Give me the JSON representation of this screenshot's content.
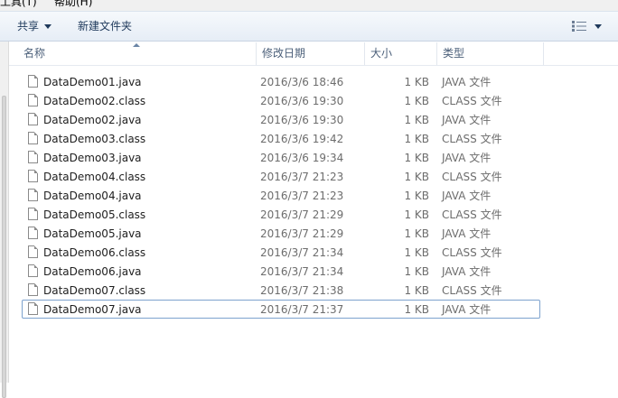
{
  "menu": {
    "tools": "工具(T)",
    "help": "帮助(H)"
  },
  "toolbar": {
    "share_label": "共享",
    "new_folder_label": "新建文件夹"
  },
  "columns": {
    "name": "名称",
    "date": "修改日期",
    "size": "大小",
    "type": "类型"
  },
  "files": [
    {
      "name": "DataDemo01.java",
      "date": "2016/3/6 18:46",
      "size": "1 KB",
      "type": "JAVA 文件"
    },
    {
      "name": "DataDemo02.class",
      "date": "2016/3/6 19:30",
      "size": "1 KB",
      "type": "CLASS 文件"
    },
    {
      "name": "DataDemo02.java",
      "date": "2016/3/6 19:30",
      "size": "1 KB",
      "type": "JAVA 文件"
    },
    {
      "name": "DataDemo03.class",
      "date": "2016/3/6 19:42",
      "size": "1 KB",
      "type": "CLASS 文件"
    },
    {
      "name": "DataDemo03.java",
      "date": "2016/3/6 19:34",
      "size": "1 KB",
      "type": "JAVA 文件"
    },
    {
      "name": "DataDemo04.class",
      "date": "2016/3/7 21:23",
      "size": "1 KB",
      "type": "CLASS 文件"
    },
    {
      "name": "DataDemo04.java",
      "date": "2016/3/7 21:23",
      "size": "1 KB",
      "type": "JAVA 文件"
    },
    {
      "name": "DataDemo05.class",
      "date": "2016/3/7 21:29",
      "size": "1 KB",
      "type": "CLASS 文件"
    },
    {
      "name": "DataDemo05.java",
      "date": "2016/3/7 21:29",
      "size": "1 KB",
      "type": "JAVA 文件"
    },
    {
      "name": "DataDemo06.class",
      "date": "2016/3/7 21:34",
      "size": "1 KB",
      "type": "CLASS 文件"
    },
    {
      "name": "DataDemo06.java",
      "date": "2016/3/7 21:34",
      "size": "1 KB",
      "type": "JAVA 文件"
    },
    {
      "name": "DataDemo07.class",
      "date": "2016/3/7 21:38",
      "size": "1 KB",
      "type": "CLASS 文件"
    },
    {
      "name": "DataDemo07.java",
      "date": "2016/3/7 21:37",
      "size": "1 KB",
      "type": "JAVA 文件"
    }
  ],
  "focused_row": 12,
  "icons": {
    "file": "document-icon",
    "view": "view-options-icon",
    "view_menu": "chevron-down-icon",
    "sort": "sort-ascending-icon"
  }
}
